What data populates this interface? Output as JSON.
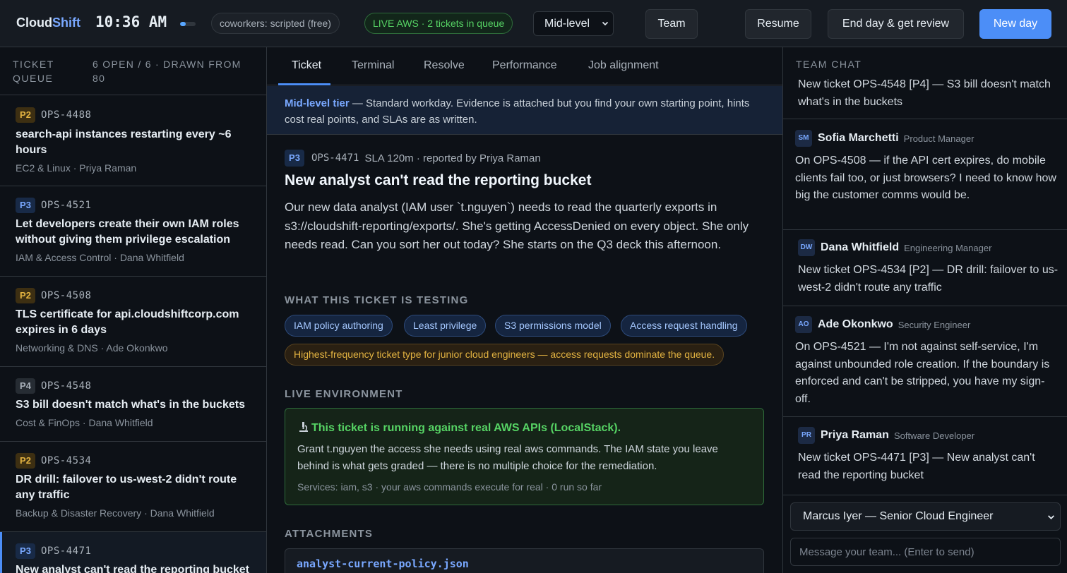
{
  "header": {
    "brand_part1": "Cloud",
    "brand_part2": "Shift",
    "clock": "10:36 AM",
    "coworkers_pill": "coworkers: scripted (free)",
    "live_pill": "LIVE AWS · 2 tickets in queue",
    "tier_value": "Mid-level",
    "team_label": "Team",
    "resume_label": "Resume",
    "end_day_label": "End day & get review",
    "new_day_label": "New day",
    "colors": {
      "accent": "#4c8ef7",
      "live_green": "#56d364",
      "warning": "#e3b341"
    }
  },
  "queue": {
    "label": "TICKET QUEUE",
    "counts": "6 OPEN / 6 · DRAWN FROM 80",
    "items": [
      {
        "priority": "P2",
        "id": "OPS-4488",
        "title": "search-api instances restarting every ~6 hours",
        "meta": "EC2 & Linux · Priya Raman"
      },
      {
        "priority": "P3",
        "id": "OPS-4521",
        "title": "Let developers create their own IAM roles without giving them privilege escalation",
        "meta": "IAM & Access Control · Dana Whitfield"
      },
      {
        "priority": "P2",
        "id": "OPS-4508",
        "title": "TLS certificate for api.cloudshiftcorp.com expires in 6 days",
        "meta": "Networking & DNS · Ade Okonkwo"
      },
      {
        "priority": "P4",
        "id": "OPS-4548",
        "title": "S3 bill doesn't match what's in the buckets",
        "meta": "Cost & FinOps · Dana Whitfield"
      },
      {
        "priority": "P2",
        "id": "OPS-4534",
        "title": "DR drill: failover to us-west-2 didn't route any traffic",
        "meta": "Backup & Disaster Recovery · Dana Whitfield"
      },
      {
        "priority": "P3",
        "id": "OPS-4471",
        "title": "New analyst can't read the reporting bucket",
        "meta": ""
      }
    ]
  },
  "tabs": [
    "Ticket",
    "Terminal",
    "Resolve",
    "Performance",
    "Job alignment"
  ],
  "tier_banner": {
    "strong": "Mid-level tier",
    "text": " — Standard workday. Evidence is attached but you find your own starting point, hints cost real points, and SLAs are as written."
  },
  "ticket": {
    "priority": "P3",
    "id": "OPS-4471",
    "sla": "SLA 120m · reported by Priya Raman",
    "title": "New analyst can't read the reporting bucket",
    "description": "Our new data analyst (IAM user `t.nguyen`) needs to read the quarterly exports in s3://cloudshift-reporting/exports/. She's getting AccessDenied on every object. She only needs read. Can you sort her out today? She starts on the Q3 deck this afternoon.",
    "testing_heading": "WHAT THIS TICKET IS TESTING",
    "skills": [
      "IAM policy authoring",
      "Least privilege",
      "S3 permissions model",
      "Access request handling"
    ],
    "note": "Highest-frequency ticket type for junior cloud engineers — access requests dominate the queue.",
    "env_heading": "LIVE ENVIRONMENT",
    "env_title": "This ticket is running against real AWS APIs (LocalStack).",
    "env_body": "Grant t.nguyen the access she needs using real aws commands. The IAM state you leave behind is what gets graded — there is no multiple choice for the remediation.",
    "env_footer": "Services: iam, s3 · your aws commands execute for real · 0 run so far",
    "attachments_heading": "ATTACHMENTS",
    "attachment_name": "analyst-current-policy.json"
  },
  "chat": {
    "heading": "TEAM CHAT",
    "messages": [
      {
        "initials": "",
        "name": "",
        "role": "",
        "text": "New ticket OPS-4548 [P4] — S3 bill doesn't match what's in the buckets"
      },
      {
        "initials": "SM",
        "name": "Sofia Marchetti",
        "role": "Product Manager",
        "text": "On OPS-4508 — if the API cert expires, do mobile clients fail too, or just browsers? I need to know how big the customer comms would be."
      },
      {
        "initials": "DW",
        "name": "Dana Whitfield",
        "role": "Engineering Manager",
        "text": "New ticket OPS-4534 [P2] — DR drill: failover to us-west-2 didn't route any traffic"
      },
      {
        "initials": "AO",
        "name": "Ade Okonkwo",
        "role": "Security Engineer",
        "text": "On OPS-4521 — I'm not against self-service, I'm against unbounded role creation. If the boundary is enforced and can't be stripped, you have my sign-off."
      },
      {
        "initials": "PR",
        "name": "Priya Raman",
        "role": "Software Developer",
        "text": "New ticket OPS-4471 [P3] — New analyst can't read the reporting bucket"
      }
    ],
    "sender": "Marcus Iyer — Senior Cloud Engineer",
    "input_placeholder": "Message your team... (Enter to send)"
  }
}
